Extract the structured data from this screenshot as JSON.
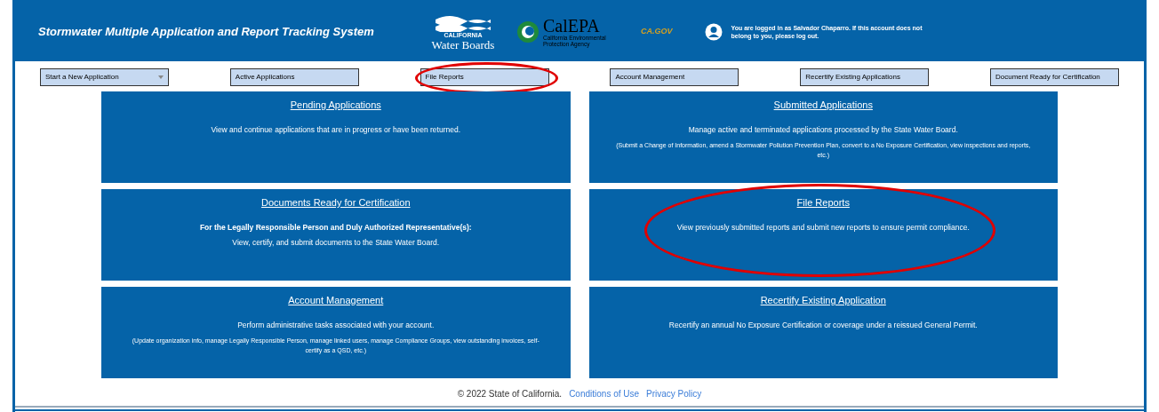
{
  "header": {
    "title": "Stormwater Multiple Application and Report Tracking System",
    "logos": [
      {
        "kind": "waterboards",
        "small": "CALIFORNIA",
        "name": "Water Boards"
      },
      {
        "kind": "calepa",
        "name": "CalEPA",
        "subtitle": "California Environmental Protection Agency"
      },
      {
        "kind": "cagov",
        "name": "CA.GOV"
      }
    ],
    "user_notice": "You are logged in as Salvador Chaparro. If this account does not belong to you, please log out."
  },
  "nav": [
    {
      "label": "Start a New Application",
      "kind": "dropdown",
      "annotated": false
    },
    {
      "label": "Active Applications",
      "kind": "button",
      "annotated": false
    },
    {
      "label": "File Reports",
      "kind": "button",
      "annotated": true
    },
    {
      "label": "Account Management",
      "kind": "button",
      "annotated": false
    },
    {
      "label": "Recertify Existing Applications",
      "kind": "button",
      "annotated": false
    },
    {
      "label": "Document Ready for Certification",
      "kind": "button",
      "annotated": false
    }
  ],
  "cards": [
    {
      "title": "Pending Applications",
      "lead": "View and continue applications that are in progress or have been returned.",
      "lead_bold": false,
      "annotated": false
    },
    {
      "title": "Submitted Applications",
      "lead": "Manage active and terminated applications processed by the State Water Board.",
      "lead_bold": false,
      "note": "(Submit a Change of Information, amend a Stormwater Pollution Prevention Plan, convert to a No Exposure Certification, view inspections and reports, etc.)",
      "annotated": false
    },
    {
      "title": "Documents Ready for Certification",
      "lead": "For the Legally Responsible Person and Duly Authorized Representative(s):",
      "lead_bold": true,
      "second": "View, certify, and submit documents to the State Water Board.",
      "annotated": false
    },
    {
      "title": "File Reports",
      "lead": "View previously submitted reports and submit new reports to ensure permit compliance.",
      "lead_bold": false,
      "annotated": true
    },
    {
      "title": "Account Management",
      "lead": "Perform administrative tasks associated with your account.",
      "lead_bold": false,
      "note": "(Update organization info, manage Legally Responsible Person, manage linked users, manage Compliance Groups, view outstanding invoices, self-certify as a QSD, etc.)",
      "annotated": false
    },
    {
      "title": "Recertify Existing Application",
      "lead": "Recertify an annual No Exposure Certification or coverage under a reissued General Permit.",
      "lead_bold": false,
      "annotated": false
    }
  ],
  "footer": {
    "copyright": "© 2022 State of California.",
    "links": [
      "Conditions of Use",
      "Privacy Policy"
    ]
  }
}
